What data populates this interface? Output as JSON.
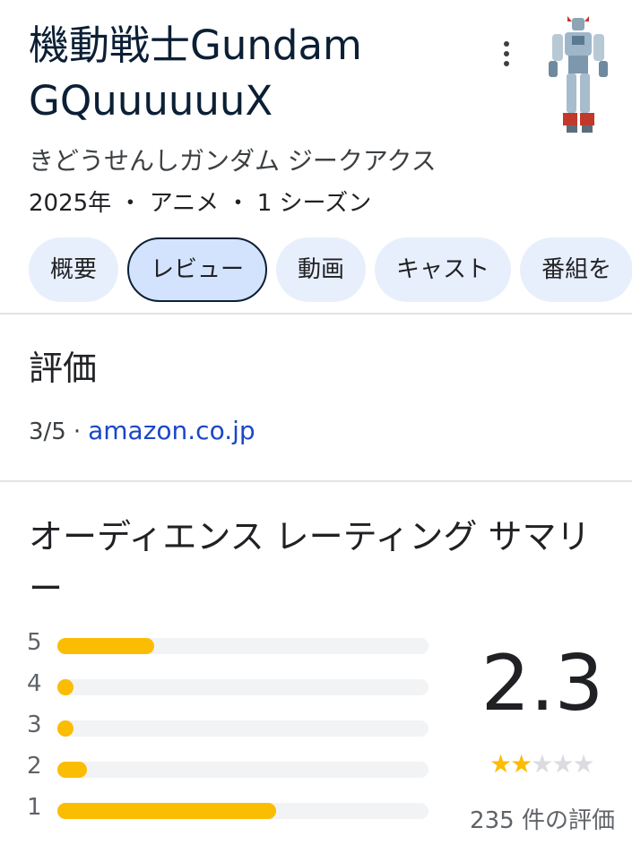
{
  "header": {
    "title": "機動戦士Gundam GQuuuuuuX",
    "reading": "きどうせんしガンダム ジークアクス",
    "meta": "2025年 ・ アニメ ・ 1 シーズン"
  },
  "tabs": [
    {
      "label": "概要",
      "active": false
    },
    {
      "label": "レビュー",
      "active": true
    },
    {
      "label": "動画",
      "active": false
    },
    {
      "label": "キャスト",
      "active": false
    },
    {
      "label": "番組を",
      "active": false
    }
  ],
  "rating_section": {
    "title": "評価",
    "score": "3/5",
    "separator": "·",
    "source": "amazon.co.jp"
  },
  "audience_summary": {
    "title": "オーディエンス レーティング サマリー",
    "average": "2.3",
    "stars_filled": 2,
    "stars_total": 5,
    "count_label": "235 件の評価",
    "distribution": [
      {
        "stars": "5",
        "fraction": 0.26
      },
      {
        "stars": "4",
        "fraction": 0.04
      },
      {
        "stars": "3",
        "fraction": 0.04
      },
      {
        "stars": "2",
        "fraction": 0.08
      },
      {
        "stars": "1",
        "fraction": 0.59
      }
    ]
  },
  "colors": {
    "accent": "#fbbc04",
    "link": "#1a47c8",
    "tab_bg": "#e8effc",
    "tab_active_bg": "#d3e3fd"
  },
  "icons": {
    "more": "more-vert-icon",
    "star": "star-icon"
  }
}
